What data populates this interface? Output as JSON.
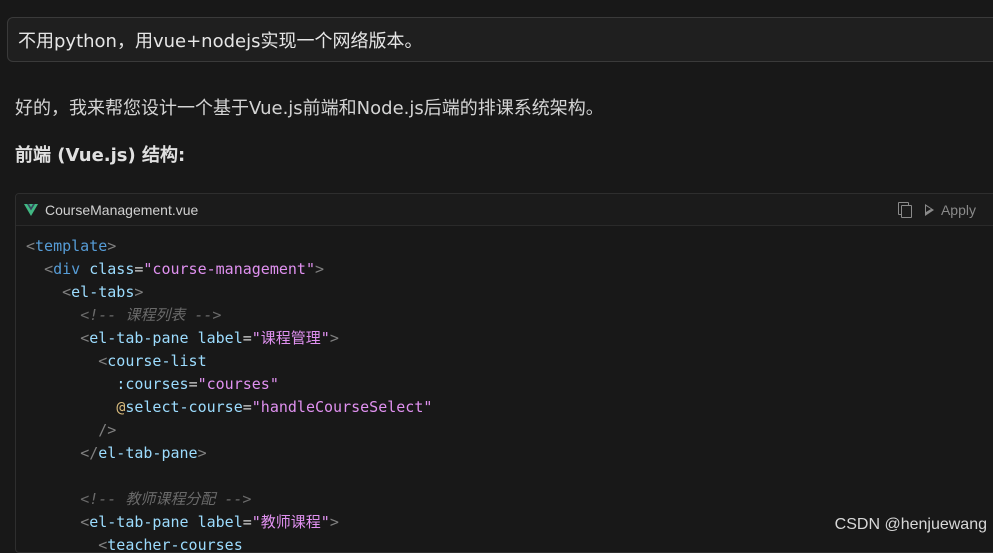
{
  "user_message": "不用python，用vue+nodejs实现一个网络版本。",
  "assistant": {
    "intro": "好的，我来帮您设计一个基于Vue.js前端和Node.js后端的排课系统架构。",
    "section_title": "前端 (Vue.js) 结构:"
  },
  "code_block": {
    "filename": "CourseManagement.vue",
    "copy_icon": "copy-icon",
    "apply_label": "Apply",
    "lines": [
      {
        "indent": "",
        "tokens": [
          [
            "t-punc",
            "<"
          ],
          [
            "t-tag",
            "template"
          ],
          [
            "t-punc",
            ">"
          ]
        ]
      },
      {
        "indent": "  ",
        "tokens": [
          [
            "t-punc",
            "<"
          ],
          [
            "t-tag",
            "div"
          ],
          [
            "t-plain",
            " "
          ],
          [
            "t-attr",
            "class"
          ],
          [
            "t-eq",
            "="
          ],
          [
            "t-str2",
            "\"course-management\""
          ],
          [
            "t-punc",
            ">"
          ]
        ]
      },
      {
        "indent": "    ",
        "tokens": [
          [
            "t-punc",
            "<"
          ],
          [
            "t-name2",
            "el-tabs"
          ],
          [
            "t-punc",
            ">"
          ]
        ]
      },
      {
        "indent": "      ",
        "tokens": [
          [
            "t-comment",
            "<!-- 课程列表 -->"
          ]
        ]
      },
      {
        "indent": "      ",
        "tokens": [
          [
            "t-punc",
            "<"
          ],
          [
            "t-name2",
            "el-tab-pane"
          ],
          [
            "t-plain",
            " "
          ],
          [
            "t-attr",
            "label"
          ],
          [
            "t-eq",
            "="
          ],
          [
            "t-str2",
            "\"课程管理\""
          ],
          [
            "t-punc",
            ">"
          ]
        ]
      },
      {
        "indent": "        ",
        "tokens": [
          [
            "t-punc",
            "<"
          ],
          [
            "t-name2",
            "course-list"
          ]
        ]
      },
      {
        "indent": "          ",
        "tokens": [
          [
            "t-attr",
            ":courses"
          ],
          [
            "t-eq",
            "="
          ],
          [
            "t-str2",
            "\"courses\""
          ]
        ]
      },
      {
        "indent": "          ",
        "tokens": [
          [
            "t-bind",
            "@"
          ],
          [
            "t-attr",
            "select-course"
          ],
          [
            "t-eq",
            "="
          ],
          [
            "t-str2",
            "\"handleCourseSelect\""
          ]
        ]
      },
      {
        "indent": "        ",
        "tokens": [
          [
            "t-punc",
            "/>"
          ]
        ]
      },
      {
        "indent": "      ",
        "tokens": [
          [
            "t-punc",
            "</"
          ],
          [
            "t-name2",
            "el-tab-pane"
          ],
          [
            "t-punc",
            ">"
          ]
        ]
      },
      {
        "indent": "",
        "tokens": []
      },
      {
        "indent": "      ",
        "tokens": [
          [
            "t-comment",
            "<!-- 教师课程分配 -->"
          ]
        ]
      },
      {
        "indent": "      ",
        "tokens": [
          [
            "t-punc",
            "<"
          ],
          [
            "t-name2",
            "el-tab-pane"
          ],
          [
            "t-plain",
            " "
          ],
          [
            "t-attr",
            "label"
          ],
          [
            "t-eq",
            "="
          ],
          [
            "t-str2",
            "\"教师课程\""
          ],
          [
            "t-punc",
            ">"
          ]
        ]
      },
      {
        "indent": "        ",
        "tokens": [
          [
            "t-punc",
            "<"
          ],
          [
            "t-name2",
            "teacher-courses"
          ]
        ]
      }
    ]
  },
  "watermark": "CSDN @henjuewang",
  "colors": {
    "background": "#181818",
    "vue_green": "#41b883",
    "vue_dark": "#35495e"
  }
}
